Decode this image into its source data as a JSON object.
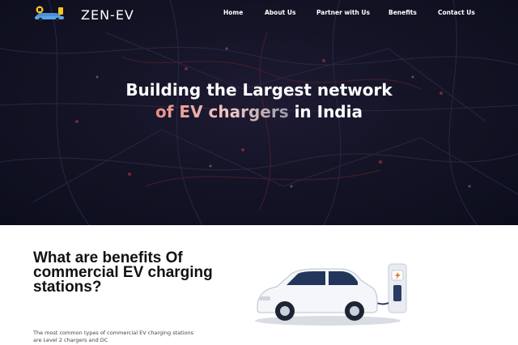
{
  "brand": {
    "name": "ZEN-EV",
    "logo_icon": "ev-car-logo-icon"
  },
  "nav": {
    "items": [
      {
        "label": "Home"
      },
      {
        "label": "About Us"
      },
      {
        "label": "Partner with Us"
      },
      {
        "label": "Benefits"
      },
      {
        "label": "Contact Us"
      }
    ]
  },
  "hero": {
    "title_line1": "Building the Largest network",
    "title_accent": "of EV chargers",
    "title_line2_rest": " in India",
    "background": "city-map-dark"
  },
  "benefits": {
    "heading": "What are benefits Of commercial EV charging stations?",
    "text": "The most common types of commercial EV charging stations are Level 2 chargers and DC",
    "illustration_icon": "ev-car-charging-illustration-icon"
  },
  "colors": {
    "hero_bg": "#141426",
    "accent": "#e98b83",
    "text_dark": "#111111"
  }
}
